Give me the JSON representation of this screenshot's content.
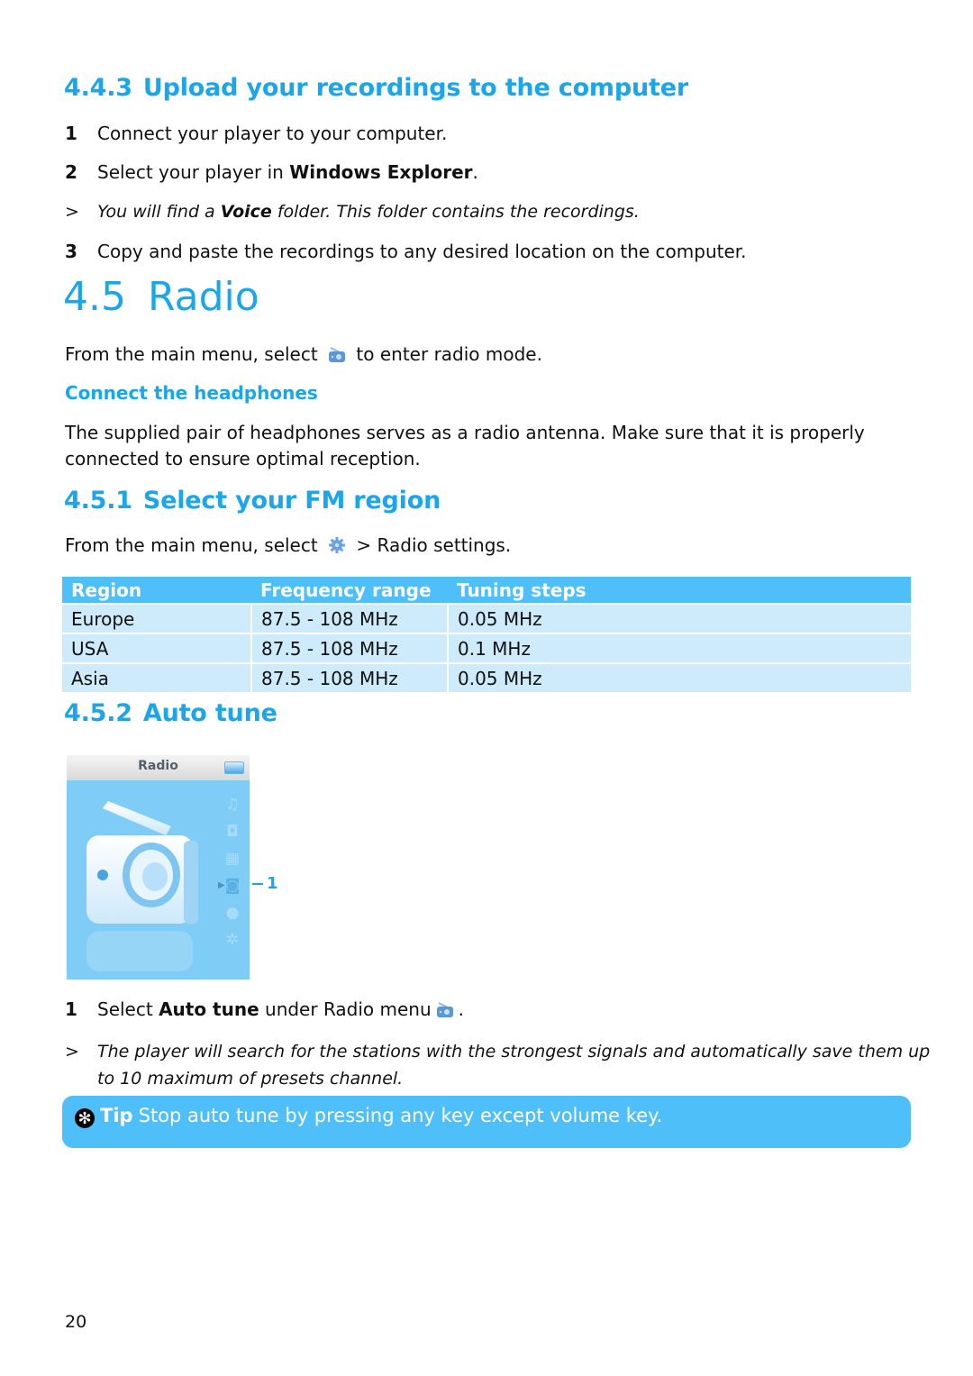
{
  "section_443": {
    "number": "4.4.3",
    "title": "Upload your recordings to the computer",
    "steps": [
      {
        "n": "1",
        "pre": "Connect your player to your computer.",
        "bold": "",
        "post": ""
      },
      {
        "n": "2",
        "pre": "Select your player in ",
        "bold": "Windows Explorer",
        "post": "."
      }
    ],
    "result": {
      "marker": ">",
      "pre": "You will find a ",
      "bold": "Voice",
      "post": " folder. This folder contains the recordings."
    },
    "step3": {
      "n": "3",
      "text": "Copy and paste the recordings to any desired location on the computer."
    }
  },
  "section_45": {
    "number": "4.5",
    "title": "Radio",
    "intro_pre": "From the main menu, select",
    "intro_icon": "radio-icon",
    "intro_post": "to enter radio mode.",
    "subheading": "Connect the headphones",
    "headphones_line1": "The supplied pair of headphones serves as a radio antenna. Make sure that it is properly",
    "headphones_line2": "connected to ensure optimal reception."
  },
  "section_451": {
    "number": "4.5.1",
    "title": "Select your FM region",
    "intro_pre": "From the main menu, select",
    "intro_icon": "settings-gear-icon",
    "intro_post": "> Radio settings.",
    "table": {
      "headers": [
        "Region",
        "Frequency range",
        "Tuning steps"
      ],
      "rows": [
        [
          "Europe",
          "87.5 - 108 MHz",
          "0.05 MHz"
        ],
        [
          "USA",
          "87.5 - 108 MHz",
          "0.1 MHz"
        ],
        [
          "Asia",
          "87.5 - 108 MHz",
          "0.05 MHz"
        ]
      ]
    }
  },
  "section_452": {
    "number": "4.5.2",
    "title": "Auto tune",
    "device_screen": {
      "title": "Radio",
      "menu_icons": [
        "music-note-icon",
        "camera-icon",
        "video-icon",
        "radio-icon",
        "microphone-icon",
        "settings-gear-icon"
      ],
      "active_menu": "radio-icon",
      "callout": "1"
    },
    "step": {
      "n": "1",
      "pre": "Select ",
      "bold": "Auto tune",
      "post": " under Radio menu",
      "icon": "radio-icon",
      "end": "."
    },
    "result": {
      "marker": ">",
      "line1": "The player will search for the stations with the strongest signals and automatically save them up",
      "line2": "to 10 maximum of presets channel."
    },
    "tip": {
      "icon": "tip-asterisk-icon",
      "label": "Tip",
      "text": "Stop auto tune by pressing any key except volume key."
    }
  },
  "page_number": "20",
  "colors": {
    "accent": "#1aa6ea",
    "table_header": "#4ebff8",
    "table_row": "#cdebfb",
    "tip_bg": "#4ebff8"
  }
}
